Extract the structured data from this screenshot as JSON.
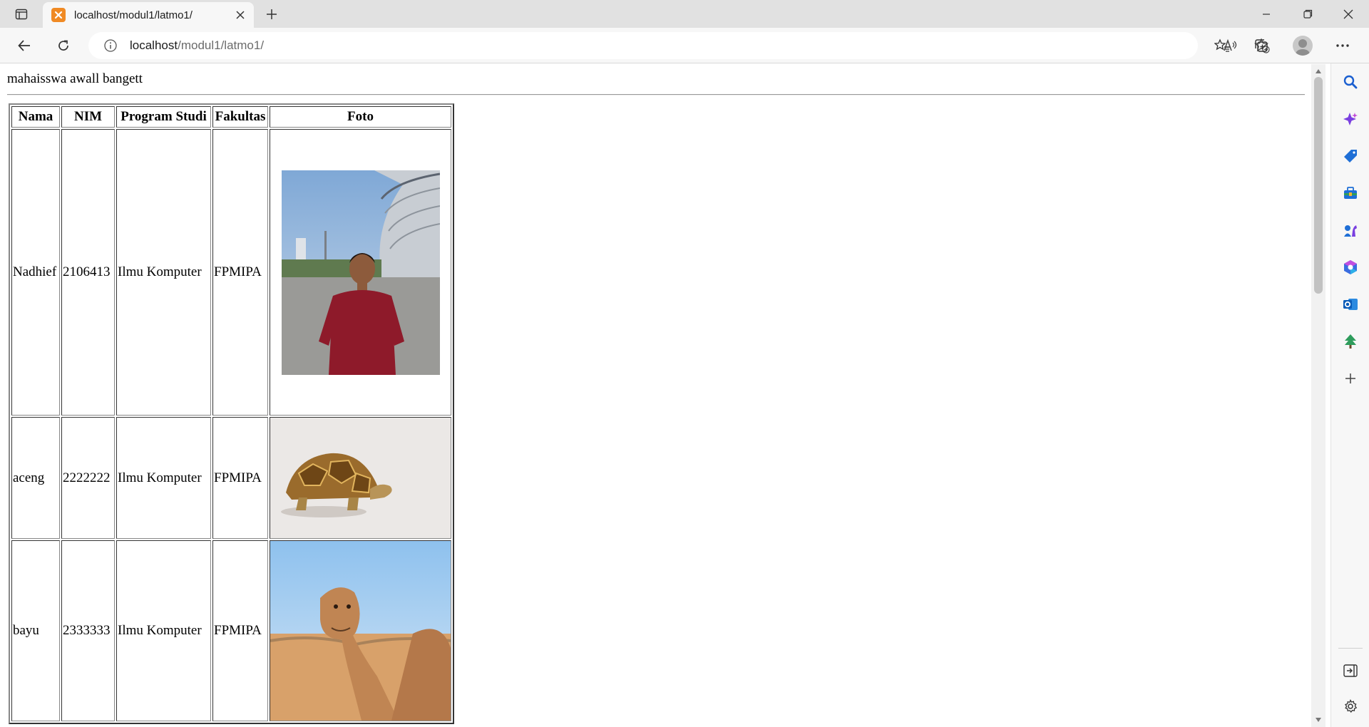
{
  "browser": {
    "tab": {
      "title": "localhost/modul1/latmo1/"
    },
    "address_bar": {
      "host": "localhost",
      "path": "/modul1/latmo1/"
    }
  },
  "page": {
    "heading": "mahaisswa awall bangett",
    "table": {
      "headers": [
        "Nama",
        "NIM",
        "Program Studi",
        "Fakultas",
        "Foto"
      ],
      "rows": [
        {
          "nama": "Nadhief",
          "nim": "2106413",
          "prodi": "Ilmu Komputer",
          "fakultas": "FPMIPA",
          "foto": "student-portrait-photo"
        },
        {
          "nama": "aceng",
          "nim": "2222222",
          "prodi": "Ilmu Komputer",
          "fakultas": "FPMIPA",
          "foto": "tortoise-photo"
        },
        {
          "nama": "bayu",
          "nim": "2333333",
          "prodi": "Ilmu Komputer",
          "fakultas": "FPMIPA",
          "foto": "camel-photo"
        }
      ]
    }
  },
  "sidebar": {
    "items": [
      "search-icon",
      "copilot-icon",
      "shopping-tag-icon",
      "tools-icon",
      "games-icon",
      "office-icon",
      "outlook-icon",
      "tree-icon",
      "add-icon"
    ],
    "bottom": [
      "hide-sidebar-icon",
      "settings-icon"
    ]
  },
  "colors": {
    "tab_favicon": "#f08a24",
    "chrome_bg": "#e1e1e1",
    "toolbar_bg": "#f7f7f7"
  }
}
